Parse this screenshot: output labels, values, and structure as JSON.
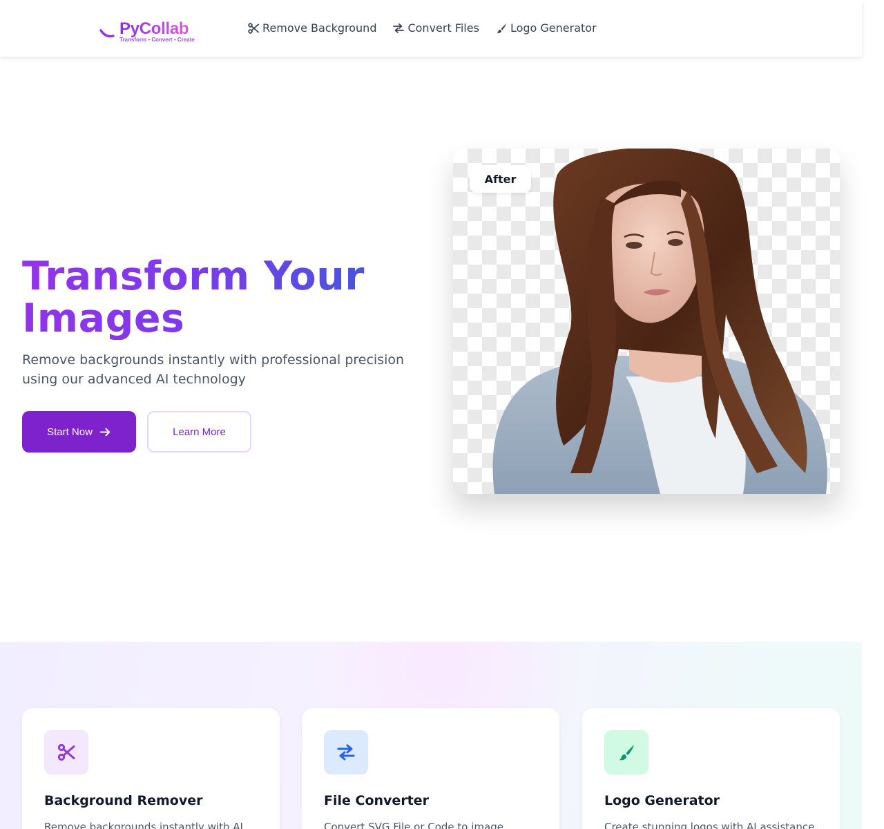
{
  "brand": {
    "name": "PyCollab",
    "tagline": "Transform • Convert • Create"
  },
  "nav": {
    "items": [
      {
        "label": "Remove Background",
        "icon": "scissors-icon"
      },
      {
        "label": "Convert Files",
        "icon": "exchange-icon"
      },
      {
        "label": "Logo Generator",
        "icon": "paintbrush-icon"
      }
    ]
  },
  "hero": {
    "title": "Transform Your Images",
    "subtitle": "Remove backgrounds instantly with professional precision using our advanced AI technology",
    "primary_button": "Start Now",
    "secondary_button": "Learn More",
    "preview_badge": "After"
  },
  "features": [
    {
      "title": "Background Remover",
      "description": "Remove backgrounds instantly with AI",
      "icon": "scissors-icon",
      "icon_bg": "#f3e8ff",
      "icon_color": "#9333ea"
    },
    {
      "title": "File Converter",
      "description": "Convert SVG File or Code to image",
      "icon": "exchange-icon",
      "icon_bg": "#dbeafe",
      "icon_color": "#2563eb"
    },
    {
      "title": "Logo Generator",
      "description": "Create stunning logos with AI assistance",
      "icon": "paintbrush-icon",
      "icon_bg": "#d1fae5",
      "icon_color": "#059669"
    }
  ],
  "colors": {
    "primary": "#7e22ce",
    "gradient_start": "#9333ea",
    "gradient_end": "#3b5bdb"
  }
}
